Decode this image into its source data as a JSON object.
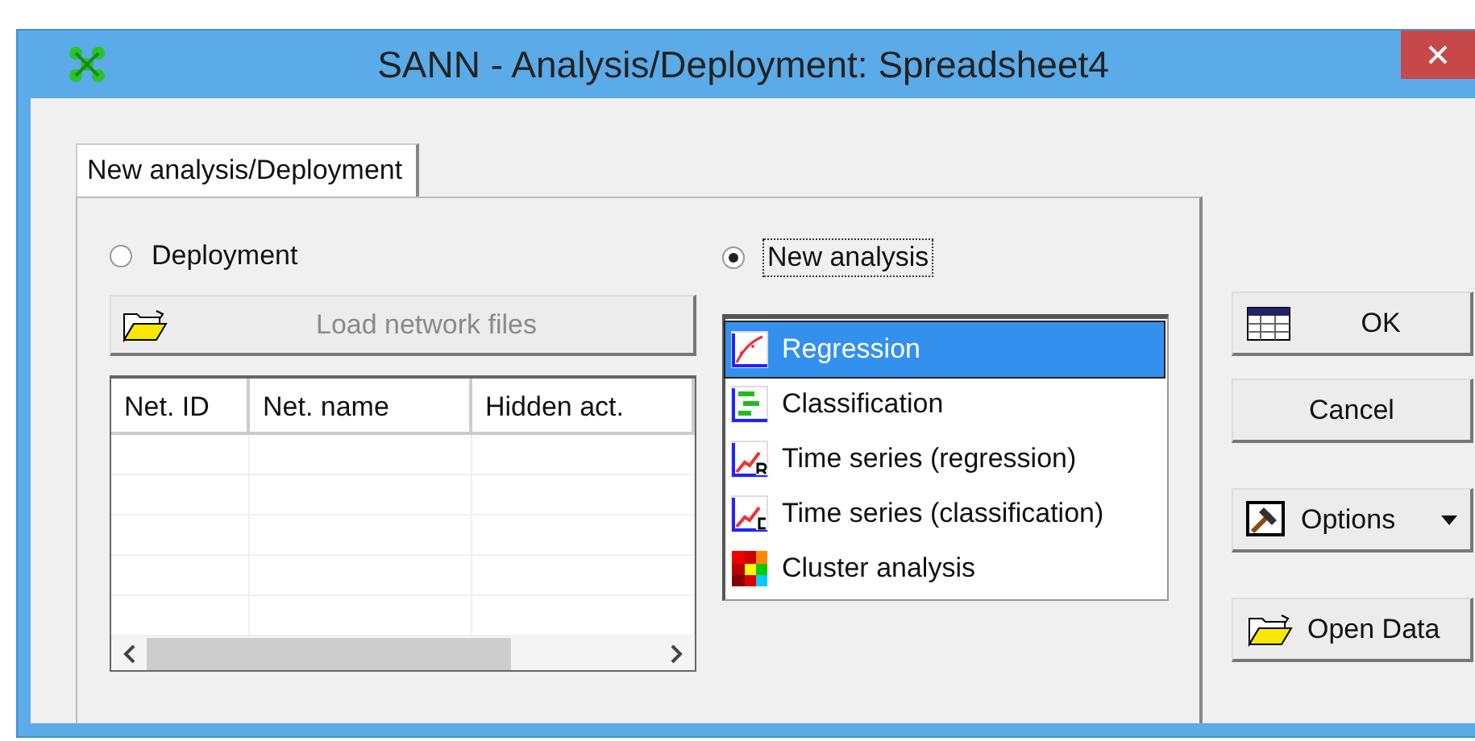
{
  "window": {
    "title": "SANN - Analysis/Deployment: Spreadsheet4"
  },
  "tabs": [
    {
      "label": "New analysis/Deployment",
      "selected": true
    }
  ],
  "modes": [
    {
      "label": "Deployment",
      "selected": false
    },
    {
      "label": "New analysis",
      "selected": true
    }
  ],
  "load_button": {
    "label": "Load network files",
    "disabled": true
  },
  "table": {
    "columns": [
      "Net. ID",
      "Net. name",
      "Hidden act."
    ]
  },
  "analysis_types": [
    {
      "label": "Regression",
      "kind": "regression",
      "selected": true
    },
    {
      "label": "Classification",
      "kind": "classification",
      "selected": false
    },
    {
      "label": "Time series (regression)",
      "kind": "ts-regression",
      "selected": false
    },
    {
      "label": "Time series (classification)",
      "kind": "ts-classification",
      "selected": false
    },
    {
      "label": "Cluster analysis",
      "kind": "cluster",
      "selected": false
    }
  ],
  "buttons": [
    {
      "label": "OK",
      "kind": "ok"
    },
    {
      "label": "Cancel",
      "kind": "plain"
    },
    {
      "label": "Options",
      "kind": "menu"
    },
    {
      "label": "Open Data",
      "kind": "open"
    }
  ]
}
